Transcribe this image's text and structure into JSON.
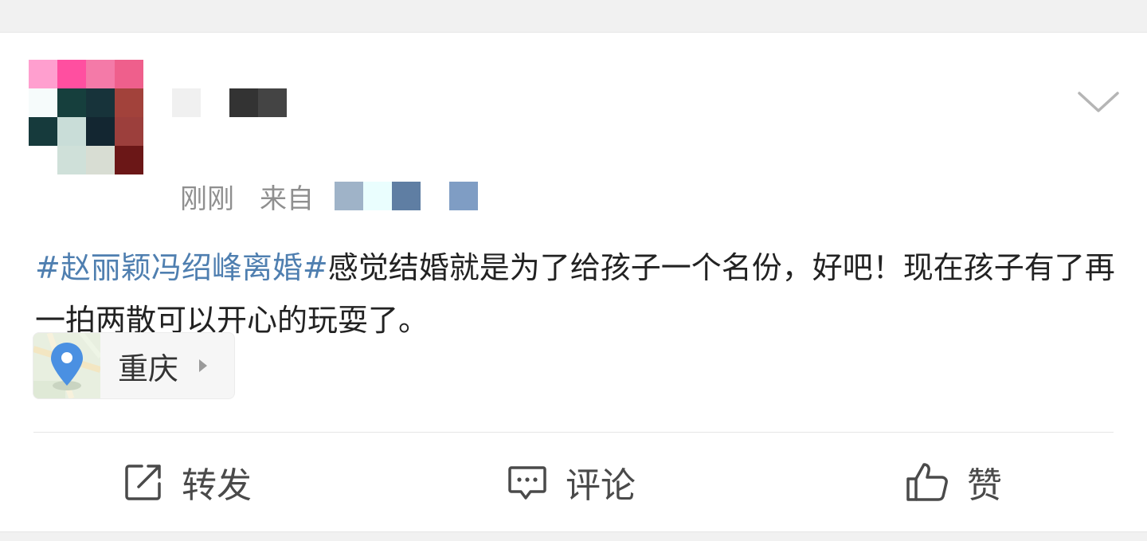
{
  "post": {
    "time": "刚刚",
    "from_label": "来自",
    "hashtag": "#赵丽颖冯绍峰离婚#",
    "body": "感觉结婚就是为了给孩子一个名份，好吧！现在孩子有了再一拍两散可以开心的玩耍了。",
    "location": "重庆"
  },
  "actions": {
    "repost": "转发",
    "comment": "评论",
    "like": "赞"
  },
  "icons": {
    "more": "chevron-down-icon",
    "location": "location-pin-icon",
    "repost": "repost-icon",
    "comment": "comment-icon",
    "like": "thumbs-up-icon"
  },
  "colors": {
    "hashtag": "#4f7fb0",
    "text": "#222222",
    "meta": "#8f8f8f",
    "pin": "#4a90e2"
  }
}
